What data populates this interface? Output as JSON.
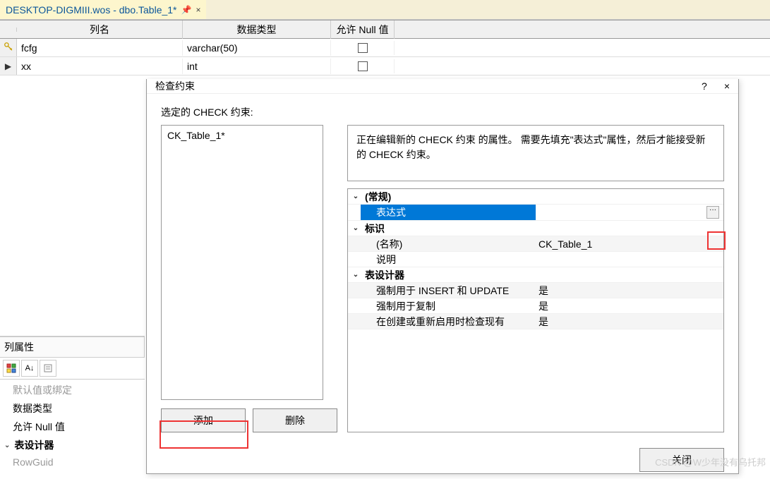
{
  "tab": {
    "title": "DESKTOP-DIGMIII.wos - dbo.Table_1*"
  },
  "table_grid": {
    "headers": {
      "col_name": "列名",
      "data_type": "数据类型",
      "allow_null": "允许 Null 值"
    },
    "rows": [
      {
        "indicator": "key",
        "name": "fcfg",
        "type": "varchar(50)",
        "allow_null": false
      },
      {
        "indicator": "arrow",
        "name": "xx",
        "type": "int",
        "allow_null": false
      }
    ]
  },
  "props_panel": {
    "title": "列属性",
    "items": [
      {
        "label": "默认值或绑定",
        "muted": true
      },
      {
        "label": "数据类型",
        "muted": false
      },
      {
        "label": "允许 Null 值",
        "muted": false
      },
      {
        "label": "表设计器",
        "muted": false,
        "bold": true,
        "expander": true
      },
      {
        "label": "RowGuid",
        "muted": true
      }
    ]
  },
  "dialog": {
    "title": "检查约束",
    "help_icon": "?",
    "close_icon": "×",
    "selected_label": "选定的 CHECK 约束:",
    "constraint_items": [
      "CK_Table_1*"
    ],
    "info_text": "正在编辑新的 CHECK 约束 的属性。   需要先填充\"表达式\"属性，然后才能接受新的 CHECK 约束。",
    "property_grid": {
      "categories": [
        {
          "name": "(常规)",
          "items": [
            {
              "label": "表达式",
              "value": "",
              "selected": true,
              "ellipsis": true
            }
          ]
        },
        {
          "name": "标识",
          "items": [
            {
              "label": "(名称)",
              "value": "CK_Table_1",
              "alt": true
            },
            {
              "label": "说明",
              "value": ""
            }
          ]
        },
        {
          "name": "表设计器",
          "items": [
            {
              "label": "强制用于 INSERT 和 UPDATE",
              "value": "是",
              "alt": true
            },
            {
              "label": "强制用于复制",
              "value": "是"
            },
            {
              "label": "在创建或重新启用时检查现有",
              "value": "是",
              "alt": true
            }
          ]
        }
      ]
    },
    "add_btn": "添加",
    "delete_btn": "删除",
    "close_btn": "关闭"
  },
  "watermark": "CSDN @W少年没有乌托邦"
}
